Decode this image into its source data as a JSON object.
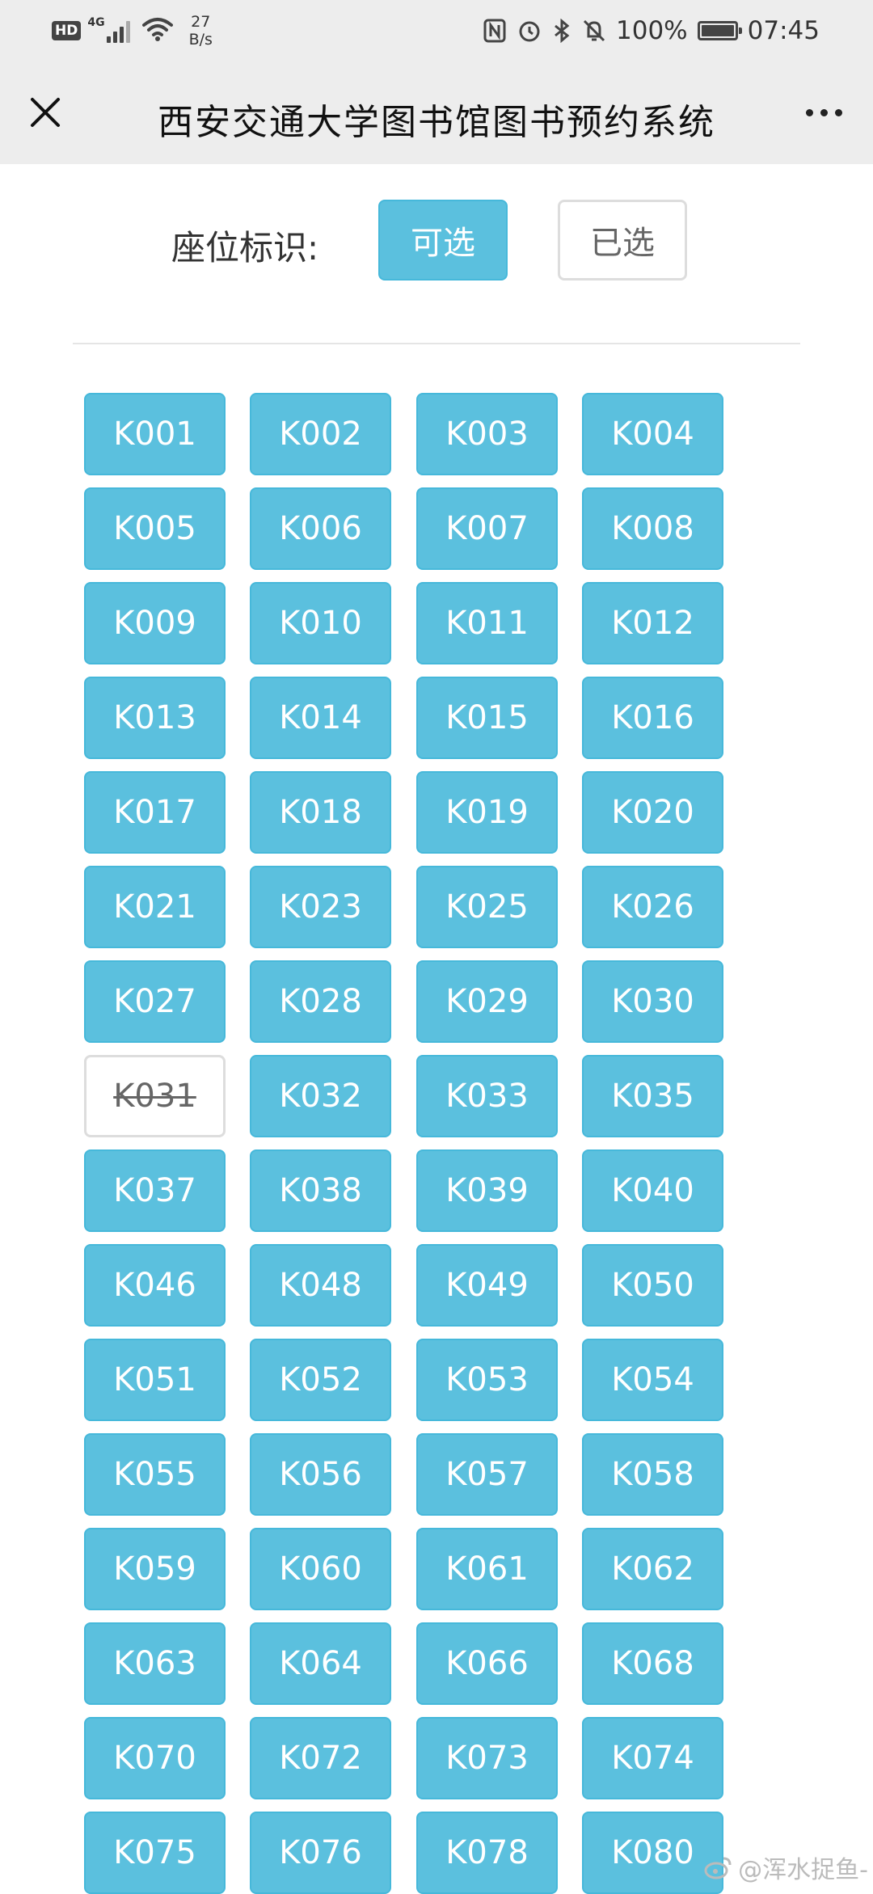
{
  "status_bar": {
    "hd": "HD",
    "network": "4G",
    "speed_value": "27",
    "speed_unit": "B/s",
    "battery": "100%",
    "time": "07:45"
  },
  "nav": {
    "title": "西安交通大学图书馆图书预约系统"
  },
  "legend": {
    "label": "座位标识:",
    "available": "可选",
    "selected": "已选"
  },
  "seats": [
    {
      "id": "K001",
      "taken": false
    },
    {
      "id": "K002",
      "taken": false
    },
    {
      "id": "K003",
      "taken": false
    },
    {
      "id": "K004",
      "taken": false
    },
    {
      "id": "K005",
      "taken": false
    },
    {
      "id": "K006",
      "taken": false
    },
    {
      "id": "K007",
      "taken": false
    },
    {
      "id": "K008",
      "taken": false
    },
    {
      "id": "K009",
      "taken": false
    },
    {
      "id": "K010",
      "taken": false
    },
    {
      "id": "K011",
      "taken": false
    },
    {
      "id": "K012",
      "taken": false
    },
    {
      "id": "K013",
      "taken": false
    },
    {
      "id": "K014",
      "taken": false
    },
    {
      "id": "K015",
      "taken": false
    },
    {
      "id": "K016",
      "taken": false
    },
    {
      "id": "K017",
      "taken": false
    },
    {
      "id": "K018",
      "taken": false
    },
    {
      "id": "K019",
      "taken": false
    },
    {
      "id": "K020",
      "taken": false
    },
    {
      "id": "K021",
      "taken": false
    },
    {
      "id": "K023",
      "taken": false
    },
    {
      "id": "K025",
      "taken": false
    },
    {
      "id": "K026",
      "taken": false
    },
    {
      "id": "K027",
      "taken": false
    },
    {
      "id": "K028",
      "taken": false
    },
    {
      "id": "K029",
      "taken": false
    },
    {
      "id": "K030",
      "taken": false
    },
    {
      "id": "K031",
      "taken": true
    },
    {
      "id": "K032",
      "taken": false
    },
    {
      "id": "K033",
      "taken": false
    },
    {
      "id": "K035",
      "taken": false
    },
    {
      "id": "K037",
      "taken": false
    },
    {
      "id": "K038",
      "taken": false
    },
    {
      "id": "K039",
      "taken": false
    },
    {
      "id": "K040",
      "taken": false
    },
    {
      "id": "K046",
      "taken": false
    },
    {
      "id": "K048",
      "taken": false
    },
    {
      "id": "K049",
      "taken": false
    },
    {
      "id": "K050",
      "taken": false
    },
    {
      "id": "K051",
      "taken": false
    },
    {
      "id": "K052",
      "taken": false
    },
    {
      "id": "K053",
      "taken": false
    },
    {
      "id": "K054",
      "taken": false
    },
    {
      "id": "K055",
      "taken": false
    },
    {
      "id": "K056",
      "taken": false
    },
    {
      "id": "K057",
      "taken": false
    },
    {
      "id": "K058",
      "taken": false
    },
    {
      "id": "K059",
      "taken": false
    },
    {
      "id": "K060",
      "taken": false
    },
    {
      "id": "K061",
      "taken": false
    },
    {
      "id": "K062",
      "taken": false
    },
    {
      "id": "K063",
      "taken": false
    },
    {
      "id": "K064",
      "taken": false
    },
    {
      "id": "K066",
      "taken": false
    },
    {
      "id": "K068",
      "taken": false
    },
    {
      "id": "K070",
      "taken": false
    },
    {
      "id": "K072",
      "taken": false
    },
    {
      "id": "K073",
      "taken": false
    },
    {
      "id": "K074",
      "taken": false
    },
    {
      "id": "K075",
      "taken": false
    },
    {
      "id": "K076",
      "taken": false
    },
    {
      "id": "K078",
      "taken": false
    },
    {
      "id": "K080",
      "taken": false
    }
  ],
  "colors": {
    "available": "#5bc0de",
    "available_border": "#46b8da",
    "taken_border": "#dddddd",
    "bar_bg": "#ededed"
  },
  "icons": [
    "close-icon",
    "more-icon",
    "wifi-icon",
    "nfc-icon",
    "alarm-icon",
    "bluetooth-icon",
    "mute-icon",
    "battery-icon",
    "weibo-icon"
  ],
  "watermark": "@浑水捉鱼-"
}
